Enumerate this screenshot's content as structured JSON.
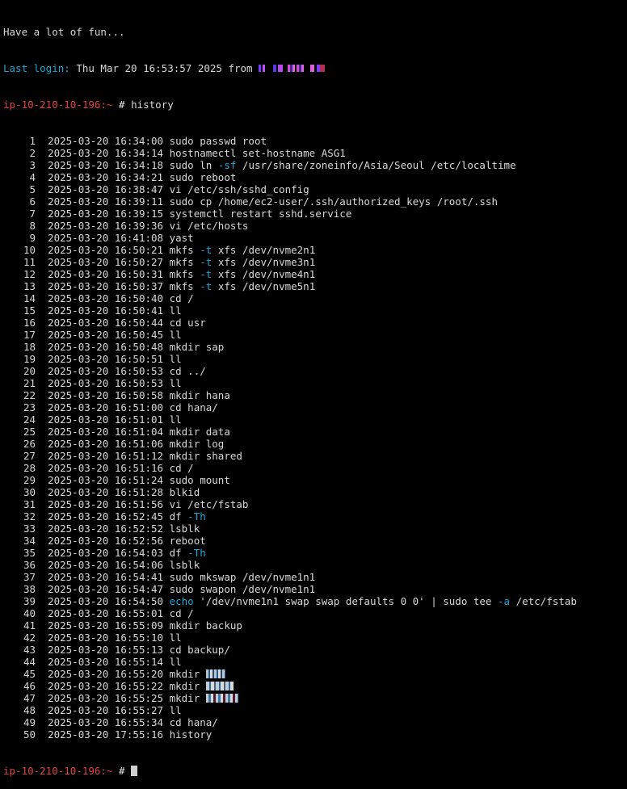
{
  "banner": "Have a lot of fun...",
  "last_login": {
    "label": "Last login:",
    "value": "Thu Mar 20 16:53:57 2025 from"
  },
  "prompt": {
    "host": "ip-10-210-10-196:~",
    "symbol": "#"
  },
  "command": "history",
  "history": [
    {
      "n": "1",
      "ts": "2025-03-20 16:34:00",
      "cmd": "sudo passwd root"
    },
    {
      "n": "2",
      "ts": "2025-03-20 16:34:14",
      "cmd": "hostnamectl set-hostname ASG1"
    },
    {
      "n": "3",
      "ts": "2025-03-20 16:34:18",
      "pre": "sudo ln ",
      "flag": "-sf",
      "post": " /usr/share/zoneinfo/Asia/Seoul /etc/localtime"
    },
    {
      "n": "4",
      "ts": "2025-03-20 16:34:21",
      "cmd": "sudo reboot"
    },
    {
      "n": "5",
      "ts": "2025-03-20 16:38:47",
      "cmd": "vi /etc/ssh/sshd_config"
    },
    {
      "n": "6",
      "ts": "2025-03-20 16:39:11",
      "cmd": "sudo cp /home/ec2-user/.ssh/authorized_keys /root/.ssh"
    },
    {
      "n": "7",
      "ts": "2025-03-20 16:39:15",
      "cmd": "systemctl restart sshd.service"
    },
    {
      "n": "8",
      "ts": "2025-03-20 16:39:36",
      "cmd": "vi /etc/hosts"
    },
    {
      "n": "9",
      "ts": "2025-03-20 16:41:08",
      "cmd": "yast"
    },
    {
      "n": "10",
      "ts": "2025-03-20 16:50:21",
      "pre": "mkfs ",
      "flag": "-t",
      "post": " xfs /dev/nvme2n1"
    },
    {
      "n": "11",
      "ts": "2025-03-20 16:50:27",
      "pre": "mkfs ",
      "flag": "-t",
      "post": " xfs /dev/nvme3n1"
    },
    {
      "n": "12",
      "ts": "2025-03-20 16:50:31",
      "pre": "mkfs ",
      "flag": "-t",
      "post": " xfs /dev/nvme4n1"
    },
    {
      "n": "13",
      "ts": "2025-03-20 16:50:37",
      "pre": "mkfs ",
      "flag": "-t",
      "post": " xfs /dev/nvme5n1"
    },
    {
      "n": "14",
      "ts": "2025-03-20 16:50:40",
      "cmd": "cd /"
    },
    {
      "n": "15",
      "ts": "2025-03-20 16:50:41",
      "cmd": "ll"
    },
    {
      "n": "16",
      "ts": "2025-03-20 16:50:44",
      "cmd": "cd usr"
    },
    {
      "n": "17",
      "ts": "2025-03-20 16:50:45",
      "cmd": "ll"
    },
    {
      "n": "18",
      "ts": "2025-03-20 16:50:48",
      "cmd": "mkdir sap"
    },
    {
      "n": "19",
      "ts": "2025-03-20 16:50:51",
      "cmd": "ll"
    },
    {
      "n": "20",
      "ts": "2025-03-20 16:50:53",
      "cmd": "cd ../"
    },
    {
      "n": "21",
      "ts": "2025-03-20 16:50:53",
      "cmd": "ll"
    },
    {
      "n": "22",
      "ts": "2025-03-20 16:50:58",
      "cmd": "mkdir hana"
    },
    {
      "n": "23",
      "ts": "2025-03-20 16:51:00",
      "cmd": "cd hana/"
    },
    {
      "n": "24",
      "ts": "2025-03-20 16:51:01",
      "cmd": "ll"
    },
    {
      "n": "25",
      "ts": "2025-03-20 16:51:04",
      "cmd": "mkdir data"
    },
    {
      "n": "26",
      "ts": "2025-03-20 16:51:06",
      "cmd": "mkdir log"
    },
    {
      "n": "27",
      "ts": "2025-03-20 16:51:12",
      "cmd": "mkdir shared"
    },
    {
      "n": "28",
      "ts": "2025-03-20 16:51:16",
      "cmd": "cd /"
    },
    {
      "n": "29",
      "ts": "2025-03-20 16:51:24",
      "cmd": "sudo mount"
    },
    {
      "n": "30",
      "ts": "2025-03-20 16:51:28",
      "cmd": "blkid"
    },
    {
      "n": "31",
      "ts": "2025-03-20 16:51:56",
      "cmd": "vi /etc/fstab"
    },
    {
      "n": "32",
      "ts": "2025-03-20 16:52:45",
      "pre": "df ",
      "flag": "-Th",
      "post": ""
    },
    {
      "n": "33",
      "ts": "2025-03-20 16:52:52",
      "cmd": "lsblk"
    },
    {
      "n": "34",
      "ts": "2025-03-20 16:52:56",
      "cmd": "reboot"
    },
    {
      "n": "35",
      "ts": "2025-03-20 16:54:03",
      "pre": "df ",
      "flag": "-Th",
      "post": ""
    },
    {
      "n": "36",
      "ts": "2025-03-20 16:54:06",
      "cmd": "lsblk"
    },
    {
      "n": "37",
      "ts": "2025-03-20 16:54:41",
      "cmd": "sudo mkswap /dev/nvme1n1"
    },
    {
      "n": "38",
      "ts": "2025-03-20 16:54:47",
      "cmd": "sudo swapon /dev/nvme1n1"
    },
    {
      "n": "39",
      "ts": "2025-03-20 16:54:50",
      "echo": "echo",
      "pre": " '/dev/nvme1n1 swap swap defaults 0 0' | sudo tee ",
      "flag": "-a",
      "post": " /etc/fstab"
    },
    {
      "n": "40",
      "ts": "2025-03-20 16:55:01",
      "cmd": "cd /"
    },
    {
      "n": "41",
      "ts": "2025-03-20 16:55:09",
      "cmd": "mkdir backup"
    },
    {
      "n": "42",
      "ts": "2025-03-20 16:55:10",
      "cmd": "ll"
    },
    {
      "n": "43",
      "ts": "2025-03-20 16:55:13",
      "cmd": "cd backup/"
    },
    {
      "n": "44",
      "ts": "2025-03-20 16:55:14",
      "cmd": "ll"
    },
    {
      "n": "45",
      "ts": "2025-03-20 16:55:20",
      "cmd": "mkdir ",
      "redact": "1"
    },
    {
      "n": "46",
      "ts": "2025-03-20 16:55:22",
      "cmd": "mkdir ",
      "redact": "2"
    },
    {
      "n": "47",
      "ts": "2025-03-20 16:55:25",
      "cmd": "mkdir ",
      "redact": "3"
    },
    {
      "n": "48",
      "ts": "2025-03-20 16:55:27",
      "cmd": "ll"
    },
    {
      "n": "49",
      "ts": "2025-03-20 16:55:34",
      "cmd": "cd hana/"
    },
    {
      "n": "50",
      "ts": "2025-03-20 17:55:16",
      "cmd": "history"
    }
  ],
  "colors": {
    "background": "#000000",
    "text": "#d8d8d8",
    "login_label": "#22a6d8",
    "prompt_host": "#e04040",
    "option_flag": "#22a6d8"
  }
}
